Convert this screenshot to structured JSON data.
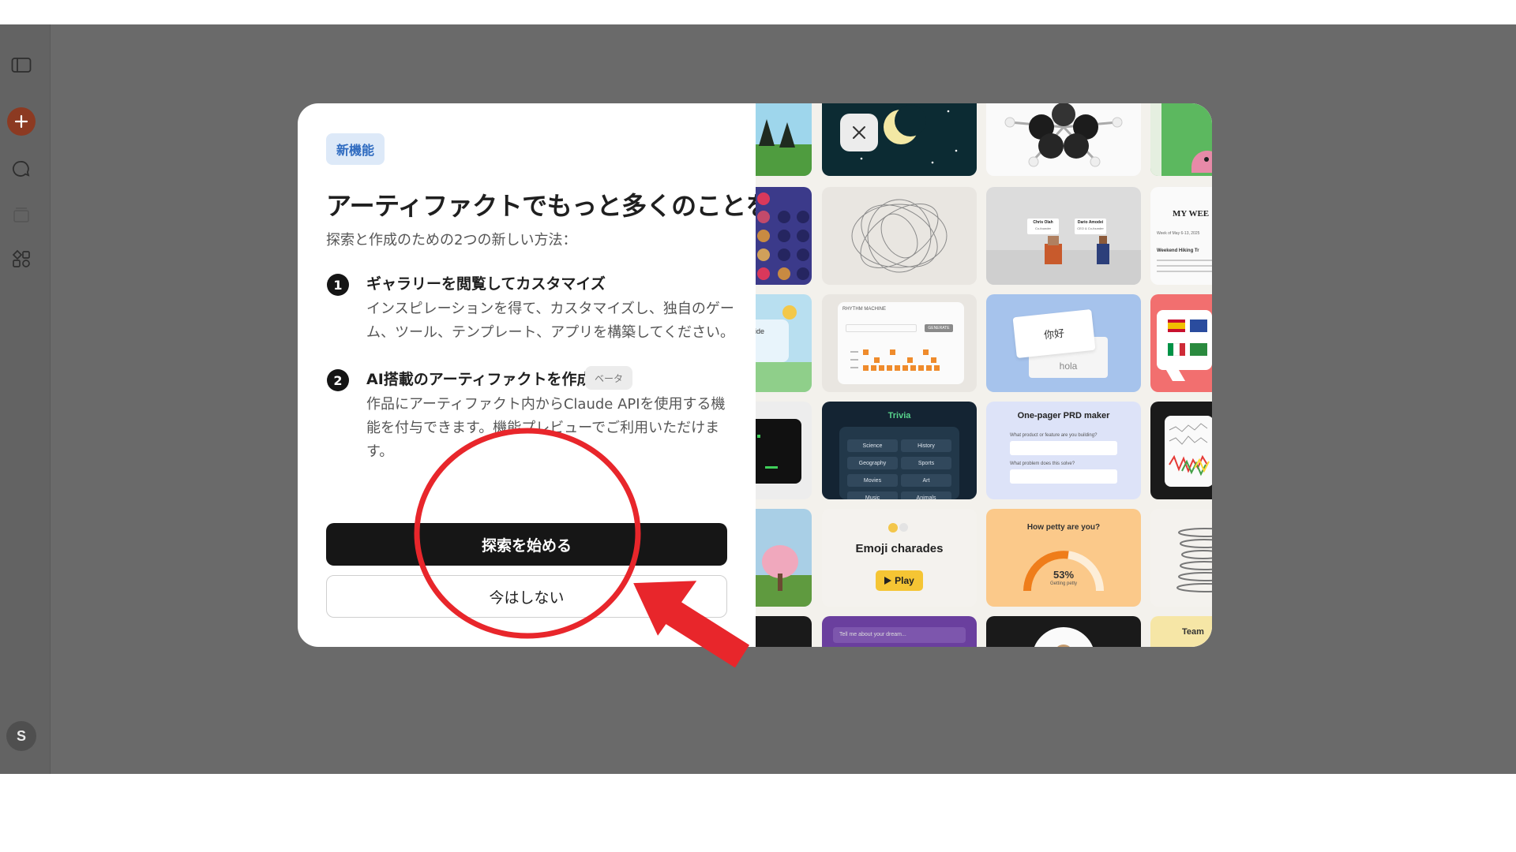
{
  "modal": {
    "badge": "新機能",
    "title": "アーティファクトでもっと多くのことを",
    "subtitle": "探索と作成のための2つの新しい方法：",
    "features": [
      {
        "number": "1",
        "title": "ギャラリーを閲覧してカスタマイズ",
        "description": "インスピレーションを得て、カスタマイズし、独自のゲーム、ツール、テンプレート、アプリを構築してください。"
      },
      {
        "number": "2",
        "title": "AI搭載のアーティファクトを作成",
        "badge": "ベータ",
        "description": "作品にアーティファクト内からClaude APIを使用する機能を付与できます。機能プレビューでご利用いただけます。"
      }
    ],
    "primary_button": "探索を始める",
    "secondary_button": "今はしない"
  },
  "sidebar": {
    "avatar_initial": "S"
  },
  "gallery": {
    "tiles": {
      "meeting_left": "Chris Olah",
      "meeting_left_sub": "Co-founder",
      "meeting_right": "Dario Amodei",
      "meeting_right_sub": "CEO & Co-founder",
      "week_title": "MY WEE",
      "week_sub": "Week of May 6-13, 2025",
      "week_heading": "Weekend Hiking Tr",
      "outside_label": "tside",
      "rhythm_title": "RHYTHM MACHINE",
      "rhythm_button": "GENERATE",
      "card_front": "你好",
      "card_back": "hola",
      "trivia_title": "Trivia",
      "trivia_categories": [
        "Science",
        "History",
        "Geography",
        "Sports",
        "Movies",
        "Art",
        "Music",
        "Animals"
      ],
      "prd_title": "One-pager PRD maker",
      "prd_q1": "What product or feature are you building?",
      "prd_q2": "What problem does this solve?",
      "emoji_title": "Emoji charades",
      "emoji_button": "Play",
      "petty_title": "How petty are you?",
      "petty_percent": "53%",
      "petty_label": "Getting petty",
      "dream_input": "Tell me about your dream...",
      "team_label": "Team"
    }
  },
  "colors": {
    "accent": "#8c3a22",
    "badge_bg": "#dde9f8",
    "badge_text": "#2f6bc0",
    "annotation_red": "#e8262b"
  }
}
